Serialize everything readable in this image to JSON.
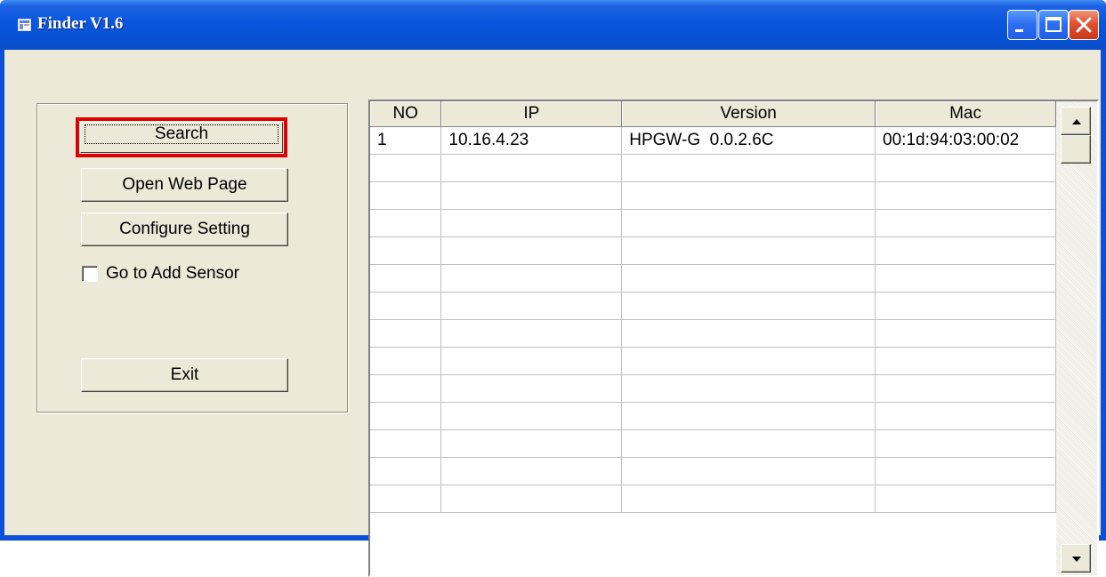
{
  "window": {
    "title": "Finder V1.6",
    "buttons": [
      "minimize",
      "maximize",
      "close"
    ]
  },
  "actions": {
    "search_label": "Search",
    "open_web_label": "Open Web Page",
    "configure_label": "Configure Setting",
    "exit_label": "Exit",
    "add_sensor_label": "Go to Add Sensor",
    "add_sensor_checked": false
  },
  "table": {
    "columns": [
      "NO",
      "IP",
      "Version",
      "Mac"
    ],
    "rows": [
      [
        "1",
        "10.16.4.23",
        "HPGW-G  0.0.2.6C",
        "00:1d:94:03:00:02"
      ]
    ],
    "empty_rows": 13
  },
  "colors": {
    "titlebar": "#0a56dc",
    "highlight": "#e00000",
    "face": "#ece9d8"
  }
}
